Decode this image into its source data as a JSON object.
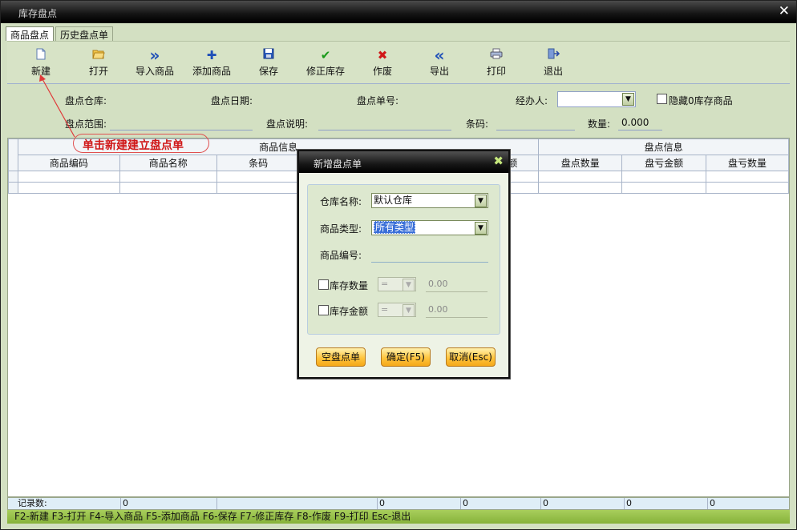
{
  "window": {
    "title": "库存盘点",
    "close": "✕"
  },
  "tabs": [
    {
      "label": "商品盘点",
      "active": true
    },
    {
      "label": "历史盘点单",
      "active": false
    }
  ],
  "toolbar": [
    {
      "label": "新建",
      "icon": "📄",
      "color": "#4a74b8"
    },
    {
      "label": "打开",
      "icon": "📂",
      "color": "#d8a020"
    },
    {
      "label": "导入商品",
      "icon": "»",
      "color": "#1e4fb8"
    },
    {
      "label": "添加商品",
      "icon": "✚",
      "color": "#1e4fb8"
    },
    {
      "label": "保存",
      "icon": "💾",
      "color": "#1e4fb8"
    },
    {
      "label": "修正库存",
      "icon": "✔",
      "color": "#1a9a1a"
    },
    {
      "label": "作废",
      "icon": "✖",
      "color": "#d01818"
    },
    {
      "label": "导出",
      "icon": "«",
      "color": "#1e4fb8"
    },
    {
      "label": "打印",
      "icon": "🖶",
      "color": "#4a74b8"
    },
    {
      "label": "退出",
      "icon": "⇥",
      "color": "#4a74b8"
    }
  ],
  "form": {
    "warehouse_label": "盘点仓库:",
    "date_label": "盘点日期:",
    "order_no_label": "盘点单号:",
    "handler_label": "经办人:",
    "hide_zero_label": "隐藏0库存商品",
    "range_label": "盘点范围:",
    "desc_label": "盘点说明:",
    "barcode_label": "条码:",
    "qty_label": "数量:",
    "qty_value": "0.000"
  },
  "annotation": "单击新建建立盘点单",
  "grid": {
    "group_product": "商品信息",
    "group_count": "盘点信息",
    "columns": [
      "商品编码",
      "商品名称",
      "条码",
      "额",
      "盘点数量",
      "盘亏金额",
      "盘亏数量"
    ]
  },
  "footer": {
    "record_label": "记录数:",
    "values": [
      "0",
      "0",
      "0",
      "0",
      "0",
      "0"
    ]
  },
  "status": "F2-新建 F3-打开 F4-导入商品 F5-添加商品 F6-保存 F7-修正库存 F8-作废 F9-打印 Esc-退出",
  "dialog": {
    "title": "新增盘点单",
    "close": "✖",
    "warehouse_label": "仓库名称:",
    "warehouse_value": "默认仓库",
    "type_label": "商品类型:",
    "type_value": "所有类型",
    "code_label": "商品编号:",
    "stock_qty_label": "库存数量",
    "stock_qty_op": "=",
    "stock_qty_value": "0.00",
    "stock_amt_label": "库存金额",
    "stock_amt_op": "=",
    "stock_amt_value": "0.00",
    "empty_button": "空盘点单",
    "ok_button": "确定(F5)",
    "cancel_button": "取消(Esc)"
  }
}
